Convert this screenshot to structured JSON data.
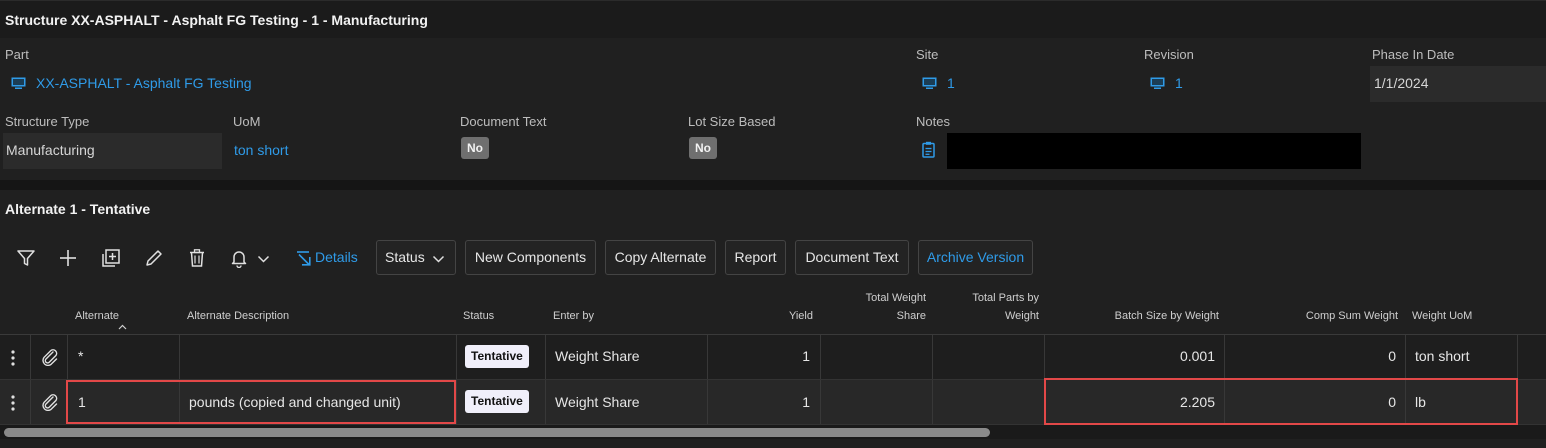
{
  "header": {
    "title": "Structure XX-ASPHALT - Asphalt FG Testing - 1 - Manufacturing"
  },
  "details": {
    "part": {
      "label": "Part",
      "value": "XX-ASPHALT - Asphalt FG Testing"
    },
    "site": {
      "label": "Site",
      "value": "1"
    },
    "revision": {
      "label": "Revision",
      "value": "1"
    },
    "phase_in_date": {
      "label": "Phase In Date",
      "value": "1/1/2024"
    },
    "structure_type": {
      "label": "Structure Type",
      "value": "Manufacturing"
    },
    "uom": {
      "label": "UoM",
      "value": "ton short"
    },
    "document_text": {
      "label": "Document Text",
      "value": "No"
    },
    "lot_size_based": {
      "label": "Lot Size Based",
      "value": "No"
    },
    "notes": {
      "label": "Notes"
    }
  },
  "alternate_section": {
    "title": "Alternate 1 - Tentative"
  },
  "toolbar": {
    "details_label": "Details",
    "status_label": "Status",
    "new_components_label": "New Components",
    "copy_alternate_label": "Copy Alternate",
    "report_label": "Report",
    "document_text_label": "Document Text",
    "archive_version_label": "Archive Version"
  },
  "grid": {
    "columns": {
      "alternate": "Alternate",
      "alternate_description": "Alternate Description",
      "status": "Status",
      "enter_by": "Enter by",
      "yield": "Yield",
      "total_weight_share_1": "Total Weight",
      "total_weight_share_2": "Share",
      "total_parts_by_weight_1": "Total Parts by",
      "total_parts_by_weight_2": "Weight",
      "batch_size_by_weight": "Batch Size by Weight",
      "comp_sum_weight": "Comp Sum Weight",
      "weight_uom": "Weight UoM"
    },
    "rows": [
      {
        "alternate": "*",
        "description": "",
        "status": "Tentative",
        "enter_by": "Weight Share",
        "yield": "1",
        "batch_size": "0.001",
        "comp_sum": "0",
        "weight_uom": "ton short"
      },
      {
        "alternate": "1",
        "description": "pounds (copied and changed unit)",
        "status": "Tentative",
        "enter_by": "Weight Share",
        "yield": "1",
        "batch_size": "2.205",
        "comp_sum": "0",
        "weight_uom": "lb"
      }
    ]
  },
  "colors": {
    "accent": "#2f9be8",
    "highlight": "#e24848",
    "background": "#202020"
  }
}
